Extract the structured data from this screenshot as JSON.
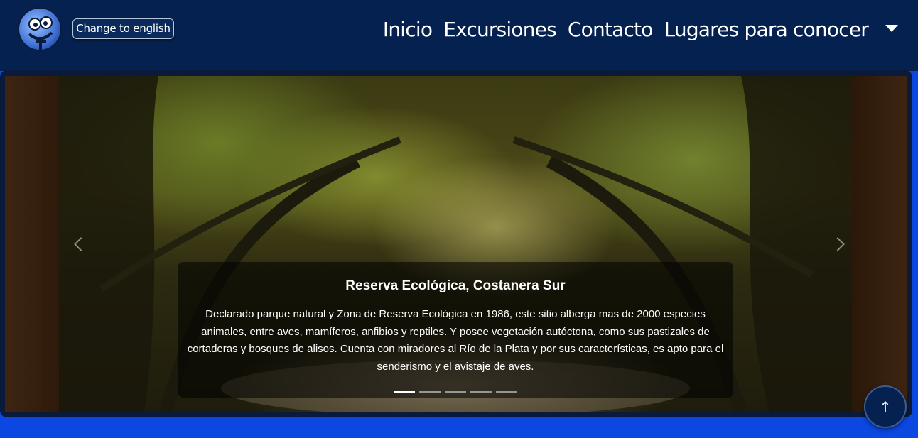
{
  "header": {
    "logo_icon": "cartoon-face-logo-icon",
    "lang_button": "Change to english",
    "nav": [
      {
        "label": "Inicio"
      },
      {
        "label": "Excursiones"
      },
      {
        "label": "Contacto"
      },
      {
        "label": "Lugares para conocer"
      }
    ],
    "dropdown_icon": "caret-down-icon"
  },
  "carousel": {
    "slide": {
      "image": "tree-tunnel-path-photo",
      "title": "Reserva Ecológica, Costanera Sur",
      "text": "Declarado parque natural y Zona de Reserva Ecológica en 1986, este sitio alberga mas de 2000 especies animales, entre aves, mamíferos, anfibios y reptiles. Y posee vegetación autóctona, como sus pastizales de cortaderas y bosques de alisos. Cuenta con miradores al Río de la Plata y por sus características, es apto para el senderismo y el avistaje de aves."
    },
    "indicator_count": 5,
    "active_indicator": 0
  },
  "scroll_top": {
    "icon": "arrow-up-icon",
    "glyph": "↑"
  },
  "colors": {
    "navbar": "#05214f",
    "page_background": "#0b47e0",
    "caption_overlay": "rgba(0,0,0,0.55)"
  }
}
